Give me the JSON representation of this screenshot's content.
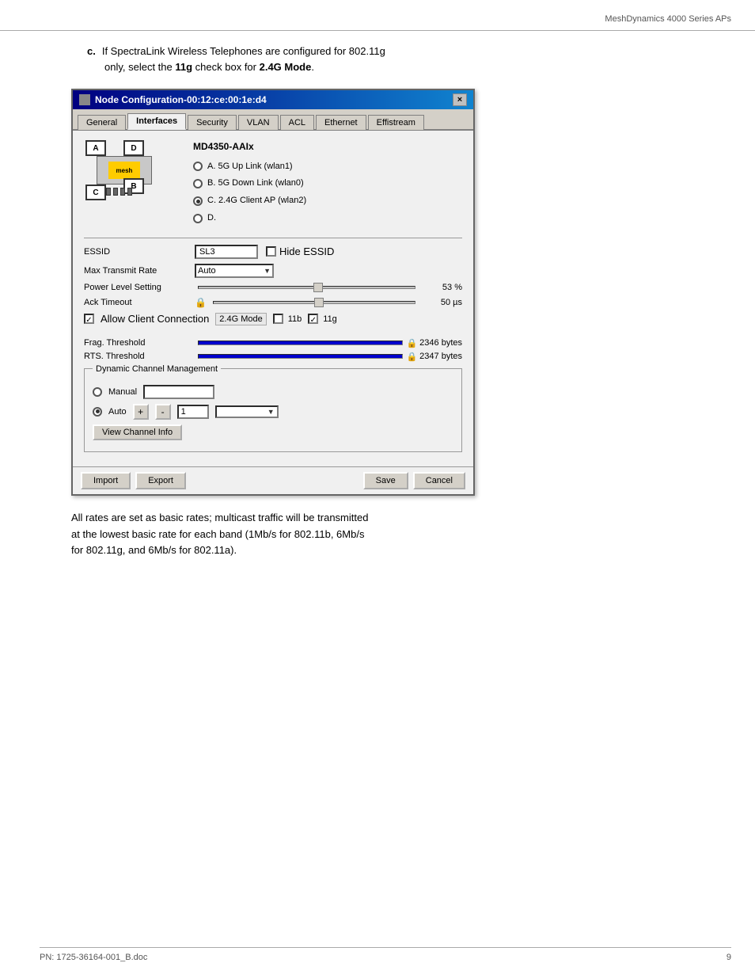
{
  "page": {
    "header": "MeshDynamics 4000 Series APs",
    "footer_left": "PN: 1725-36164-001_B.doc",
    "footer_right": "9"
  },
  "intro": {
    "bullet": "c.",
    "text1": "If SpectraLink Wireless Telephones are configured for 802.11g",
    "text2": "only, select the ",
    "bold1": "11g",
    "text3": " check box for ",
    "bold2": "2.4G Mode",
    "text4": "."
  },
  "dialog": {
    "title": "Node Configuration-00:12:ce:00:1e:d4",
    "close_btn": "×",
    "tabs": [
      "General",
      "Interfaces",
      "Security",
      "VLAN",
      "ACL",
      "Ethernet",
      "Effistream"
    ],
    "active_tab": "Interfaces",
    "device_model": "MD4350-AAIx",
    "radio_options": [
      {
        "label": "A. 5G  Up Link (wlan1)",
        "selected": false
      },
      {
        "label": "B. 5G  Down Link (wlan0)",
        "selected": false
      },
      {
        "label": "C. 2.4G  Client AP (wlan2)",
        "selected": true
      },
      {
        "label": "D.",
        "selected": false
      }
    ],
    "diagram_labels": {
      "a": "A",
      "b": "B",
      "c": "C",
      "d": "D",
      "mesh": "mesh"
    },
    "essid_label": "ESSID",
    "essid_value": "SL3",
    "hide_essid_label": "Hide ESSID",
    "hide_essid_checked": false,
    "max_transmit_label": "Max Transmit Rate",
    "max_transmit_value": "Auto",
    "power_level_label": "Power Level Setting",
    "power_level_value": "53 %",
    "power_level_pct": 53,
    "ack_timeout_label": "Ack Timeout",
    "ack_timeout_value": "50 µs",
    "ack_timeout_pct": 50,
    "allow_client_label": "Allow Client Connection",
    "allow_client_checked": true,
    "mode_2g_label": "2.4G Mode",
    "mode_11b_label": "11b",
    "mode_11b_checked": false,
    "mode_11g_label": "11g",
    "mode_11g_checked": true,
    "frag_threshold_label": "Frag. Threshold",
    "frag_threshold_value": "2346 bytes",
    "rts_threshold_label": "RTS. Threshold",
    "rts_threshold_value": "2347 bytes",
    "dcm_title": "Dynamic Channel Management",
    "dcm_manual_label": "Manual",
    "dcm_auto_label": "Auto",
    "dcm_plus": "+",
    "dcm_minus": "-",
    "dcm_auto_value": "1",
    "view_channel_label": "View Channel Info",
    "import_btn": "Import",
    "export_btn": "Export",
    "save_btn": "Save",
    "cancel_btn": "Cancel"
  },
  "below_text": {
    "line1": "All rates are set as basic rates; multicast traffic will be transmitted",
    "line2": "at the lowest basic rate for each band (1Mb/s for 802.11b, 6Mb/s",
    "line3": "for 802.11g, and 6Mb/s for 802.11a)."
  }
}
